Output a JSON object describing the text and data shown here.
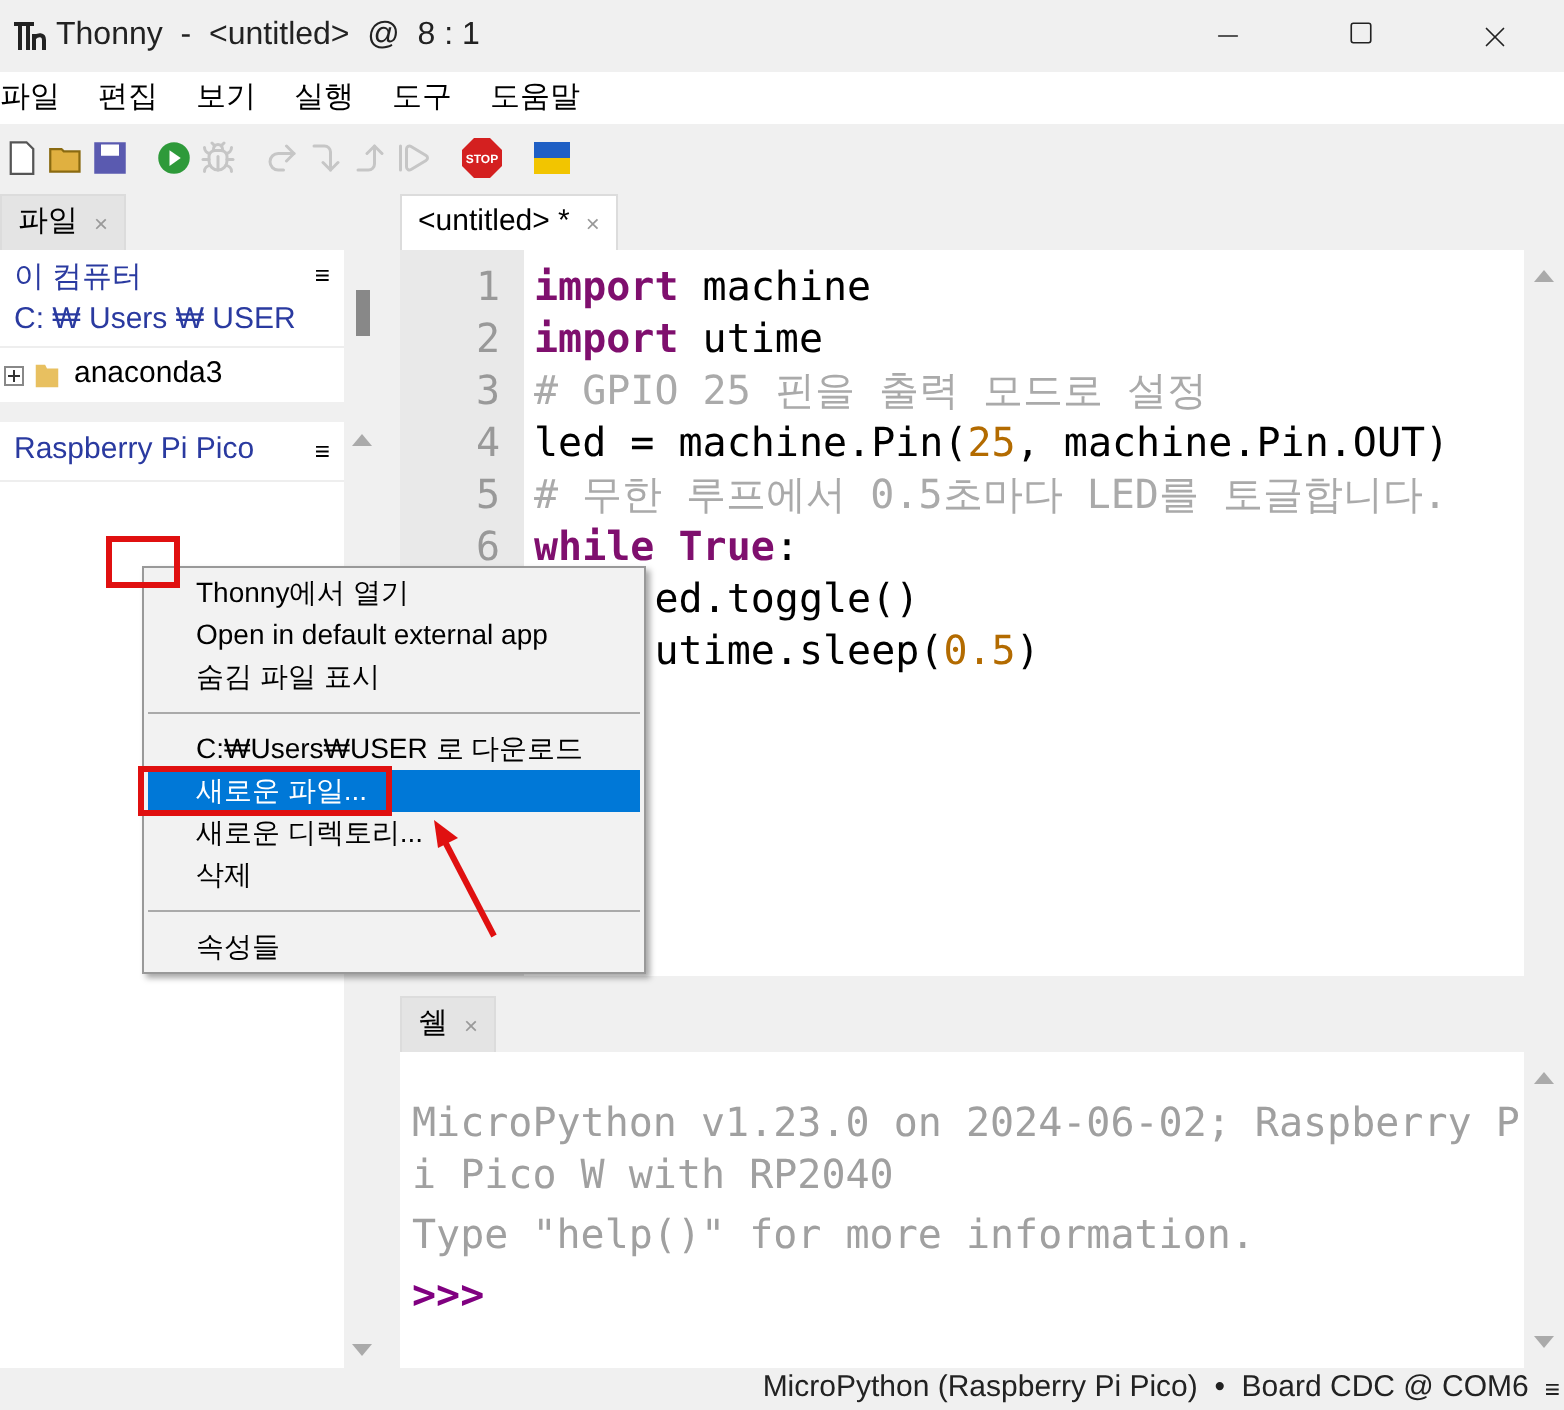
{
  "window": {
    "title": "Thonny  -  <untitled>  @  8 : 1"
  },
  "menu_bar": [
    "파일",
    "편집",
    "보기",
    "실행",
    "도구",
    "도움말"
  ],
  "toolbar": [
    [
      {
        "kind": "new",
        "disabled": false
      },
      {
        "kind": "open",
        "disabled": false
      },
      {
        "kind": "save",
        "disabled": false
      }
    ],
    [
      {
        "kind": "run",
        "disabled": false
      },
      {
        "kind": "debug",
        "disabled": true
      }
    ],
    [
      {
        "kind": "step_over",
        "disabled": true
      },
      {
        "kind": "step_into",
        "disabled": true
      },
      {
        "kind": "step_out",
        "disabled": true
      },
      {
        "kind": "resume",
        "disabled": true
      }
    ],
    [
      {
        "kind": "stop",
        "disabled": false,
        "label": "STOP"
      }
    ],
    [
      {
        "kind": "flag",
        "disabled": false
      }
    ]
  ],
  "files_panel": {
    "tab": {
      "label": "파일",
      "close": "×"
    },
    "computer": {
      "title": "이 컴퓨터",
      "path": "C: ₩ Users ₩ USER",
      "menu": "≡",
      "items": [
        {
          "name": "anaconda3",
          "expanded": false
        }
      ]
    },
    "device": {
      "title": "Raspberry Pi Pico",
      "menu": "≡"
    }
  },
  "editor": {
    "tab": {
      "label": "<untitled> *",
      "close": "×",
      "selected": true
    },
    "lines": [
      {
        "number": "1",
        "kind": "full",
        "tokens": [
          {
            "text": "import",
            "kind": "keyword"
          },
          {
            "text": " machine",
            "kind": "name"
          }
        ]
      },
      {
        "number": "2",
        "kind": "full",
        "tokens": [
          {
            "text": "import",
            "kind": "keyword"
          },
          {
            "text": " utime",
            "kind": "name"
          }
        ]
      },
      {
        "number": "3",
        "kind": "full",
        "tokens": [
          {
            "text": "# GPIO 25 핀을 출력 모드로 설정",
            "kind": "comment"
          }
        ]
      },
      {
        "number": "4",
        "kind": "full",
        "tokens": [
          {
            "text": "led = machine.Pin(",
            "kind": "name"
          },
          {
            "text": "25",
            "kind": "number"
          },
          {
            "text": ", machine.Pin.OUT)",
            "kind": "name"
          }
        ]
      },
      {
        "number": "5",
        "kind": "full",
        "tokens": [
          {
            "text": "# 무한 루프에서 0.5초마다 LED를 토글합니다.",
            "kind": "comment"
          }
        ]
      },
      {
        "number": "6",
        "kind": "full",
        "tokens": [
          {
            "text": "while",
            "kind": "keyword"
          },
          {
            "text": " True",
            "kind": "keyword"
          },
          {
            "text": ":",
            "kind": "name"
          }
        ]
      },
      {
        "kind": "partly_covered",
        "tokens": [
          {
            "text": "ed.toggle()",
            "kind": "name"
          }
        ]
      },
      {
        "kind": "partly_covered",
        "tokens": [
          {
            "text": "utime.sleep(",
            "kind": "name"
          },
          {
            "text": "0.5",
            "kind": "number"
          },
          {
            "text": ")",
            "kind": "name"
          }
        ]
      }
    ]
  },
  "shell": {
    "tab": {
      "label": "쉘",
      "close": "×"
    },
    "output": [
      "MicroPython v1.23.0 on 2024-06-02; Raspberry Pi Pico W with RP2040",
      "Type \"help()\" for more information."
    ],
    "prompt": ">>>"
  },
  "context_menu": {
    "groups": [
      [
        {
          "label": "Thonny에서 열기",
          "selected": false
        },
        {
          "label": "Open in default external app",
          "selected": false
        },
        {
          "label": "숨김 파일 표시",
          "selected": false
        }
      ],
      [
        {
          "label": "C:₩Users₩USER 로 다운로드",
          "selected": false
        },
        {
          "label": "새로운 파일...",
          "selected": true
        },
        {
          "label": "새로운 디렉토리...",
          "selected": false
        },
        {
          "label": "삭제",
          "selected": false
        }
      ],
      [
        {
          "label": "속성들",
          "selected": false
        }
      ]
    ]
  },
  "status_bar": {
    "text": "MicroPython (Raspberry Pi Pico)  •  Board CDC @ COM6",
    "menu": "≡"
  }
}
